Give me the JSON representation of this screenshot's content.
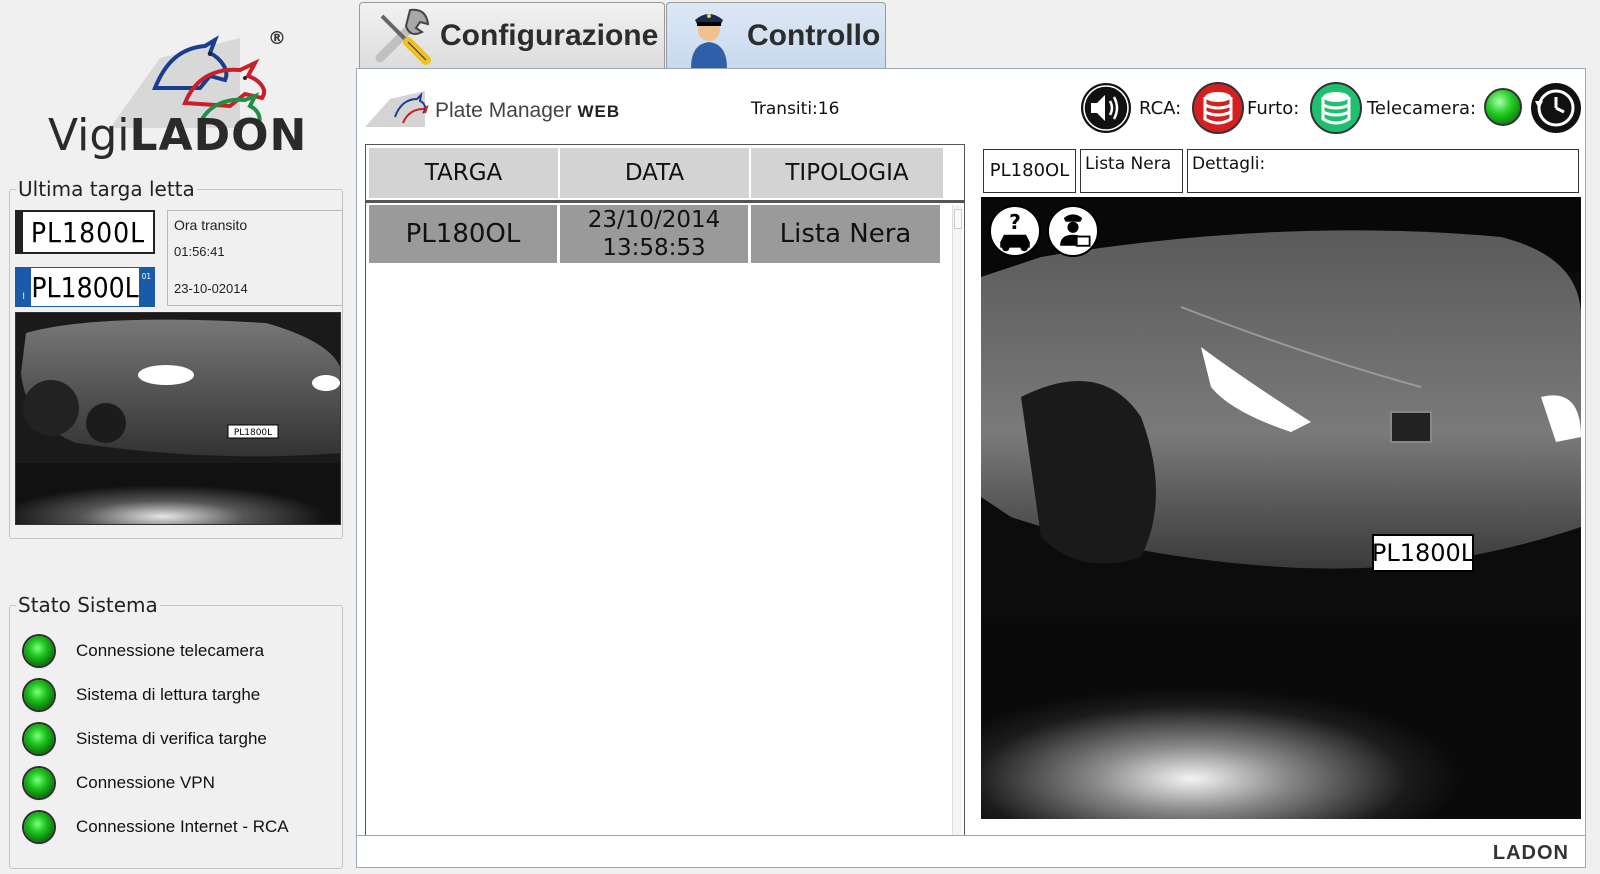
{
  "app": {
    "logo_light": "Vigi",
    "logo_bold": "LADON",
    "logo_reg": "®"
  },
  "last_plate": {
    "title": "Ultima targa letta",
    "plate_crop": "PL1800L",
    "plate_read": "PL1800L",
    "plate_small_in_image": "PL1800L",
    "eu_country": "I",
    "eu_year": "01",
    "time_label": "Ora transito",
    "time_value": "01:56:41",
    "date_value": "23-10-02014"
  },
  "system_status": {
    "title": "Stato Sistema",
    "items": [
      {
        "label": "Connessione telecamera",
        "color": "#1fc41f"
      },
      {
        "label": "Sistema di lettura targhe",
        "color": "#1fc41f"
      },
      {
        "label": "Sistema di verifica targhe",
        "color": "#1fc41f"
      },
      {
        "label": "Connessione VPN",
        "color": "#1fc41f"
      },
      {
        "label": "Connessione Internet - RCA",
        "color": "#1fc41f"
      }
    ]
  },
  "tabs": [
    {
      "label": "Configurazione",
      "icon": "tools-icon",
      "active": false
    },
    {
      "label": "Controllo",
      "icon": "police-officer-icon",
      "active": true
    }
  ],
  "header": {
    "product_name": "Plate Manager",
    "product_suffix": "WEB",
    "transits": "Transiti:16",
    "rca_label": "RCA:",
    "furto_label": "Furto:",
    "camera_label": "Telecamera:",
    "rca_status_color": "#d42020",
    "furto_status_color": "#1fbf70",
    "camera_status_color": "#20c020"
  },
  "table": {
    "headers": [
      "TARGA",
      "DATA",
      "TIPOLOGIA"
    ],
    "rows": [
      {
        "plate": "PL180OL",
        "date": "23/10/2014",
        "time": "13:58:53",
        "type": "Lista Nera"
      }
    ]
  },
  "detail": {
    "plate": "PL180OL",
    "type": "Lista Nera",
    "details_label": "Dettagli:",
    "plate_in_image": "PL1800L"
  },
  "footer": {
    "logo": "LADON"
  }
}
